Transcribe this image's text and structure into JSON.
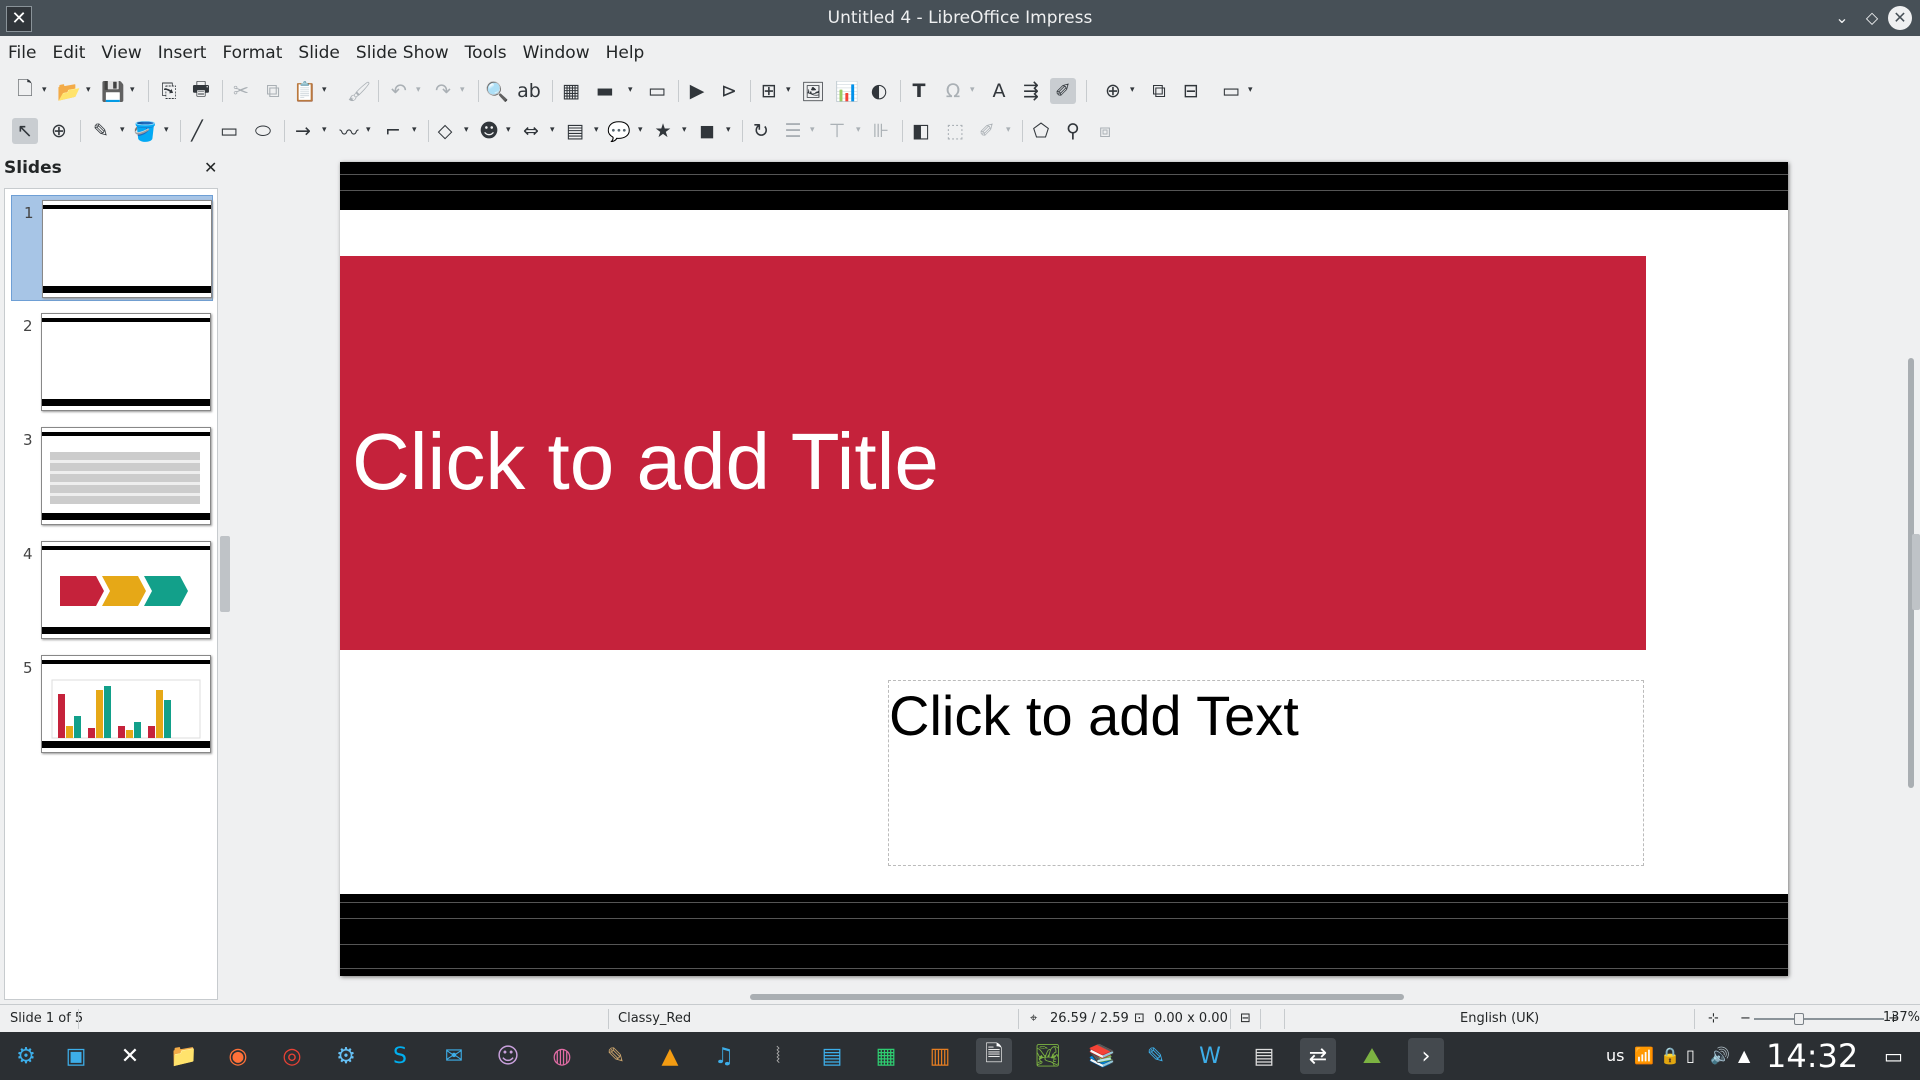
{
  "window": {
    "title": "Untitled 4 - LibreOffice Impress"
  },
  "menu": [
    "File",
    "Edit",
    "View",
    "Insert",
    "Format",
    "Slide",
    "Slide Show",
    "Tools",
    "Window",
    "Help"
  ],
  "slides_panel": {
    "title": "Slides",
    "thumbs": [
      {
        "num": "1",
        "kind": "title",
        "selected": true
      },
      {
        "num": "2",
        "kind": "blank"
      },
      {
        "num": "3",
        "kind": "table"
      },
      {
        "num": "4",
        "kind": "arrows"
      },
      {
        "num": "5",
        "kind": "chart"
      }
    ]
  },
  "slide": {
    "title_placeholder": "Click to add Title",
    "text_placeholder": "Click to add Text",
    "accent_color": "#c5223b"
  },
  "status": {
    "slide_info": "Slide 1 of 5",
    "master": "Classy_Red",
    "position": "26.59 / 2.59",
    "size": "0.00 x 0.00",
    "language": "English (UK)",
    "zoom": "137%"
  },
  "taskbar": {
    "keyboard": "us",
    "clock": "14:32"
  }
}
